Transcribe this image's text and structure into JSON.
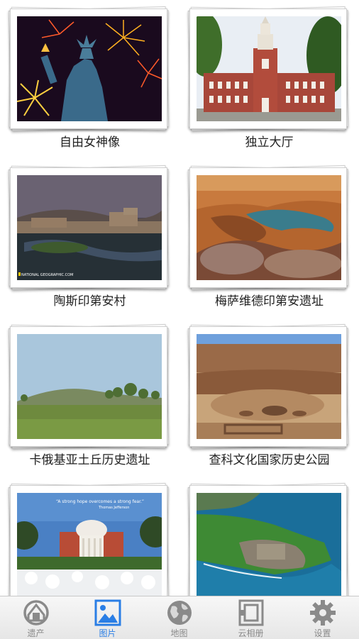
{
  "gallery": {
    "items": [
      {
        "title": "自由女神像"
      },
      {
        "title": "独立大厅"
      },
      {
        "title": "陶斯印第安村"
      },
      {
        "title": "梅萨维德印第安遗址"
      },
      {
        "title": "卡俄基亚土丘历史遗址"
      },
      {
        "title": "查科文化国家历史公园"
      },
      {
        "title": ""
      },
      {
        "title": ""
      }
    ],
    "photo_watermark": "NATIONAL GEOGRAPHIC.COM",
    "photo_quote": "“A strong hope overcomes a strong fear.”",
    "photo_quote_author": "Thomas Jefferson"
  },
  "tabbar": {
    "tabs": [
      {
        "label": "遗产",
        "icon": "heritage-logo-icon",
        "active": false
      },
      {
        "label": "图片",
        "icon": "picture-icon",
        "active": true
      },
      {
        "label": "地图",
        "icon": "globe-icon",
        "active": false
      },
      {
        "label": "云相册",
        "icon": "cloud-album-icon",
        "active": false
      },
      {
        "label": "设置",
        "icon": "gear-icon",
        "active": false
      }
    ],
    "active_color": "#2a7ee5",
    "inactive_color": "#8a8a8a"
  }
}
